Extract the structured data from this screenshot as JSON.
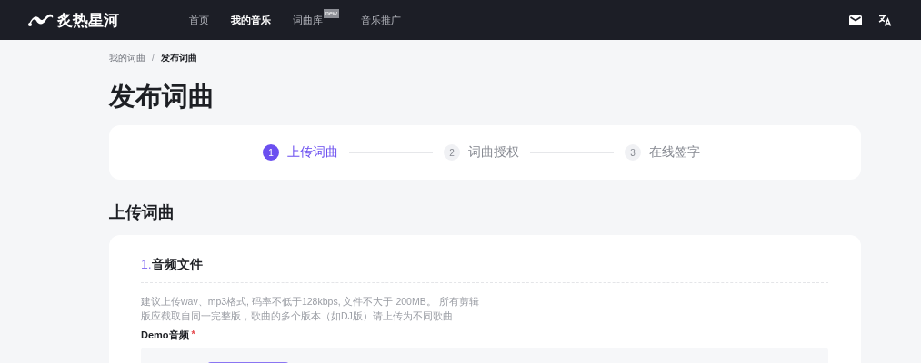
{
  "header": {
    "logo": "炙热星河",
    "nav": [
      {
        "label": "首页",
        "selected": false
      },
      {
        "label": "我的音乐",
        "selected": true
      },
      {
        "label": "词曲库",
        "badge": "new",
        "selected": false
      },
      {
        "label": "音乐推广",
        "selected": false
      }
    ]
  },
  "breadcrumb": [
    "我的词曲",
    "发布词曲"
  ],
  "breadcrumb_separator": "/",
  "page_title": "发布词曲",
  "steps": [
    {
      "number": "1",
      "label": "上传词曲",
      "selected": true
    },
    {
      "number": "2",
      "label": "词曲授权",
      "selected": false
    },
    {
      "number": "3",
      "label": "在线签字",
      "selected": false
    }
  ],
  "section_title": "上传词曲",
  "form": {
    "heading_number": "1.",
    "heading": "音频文件",
    "hint": "建议上传wav、mp3格式, 码率不低于128kbps, 文件不大于 200MB。 所有剪辑版应截取自同一完整版，歌曲的多个版本（如DJ版）请上传为不同歌曲",
    "field_label": "Demo音频",
    "required": true,
    "required_mark": "*"
  }
}
